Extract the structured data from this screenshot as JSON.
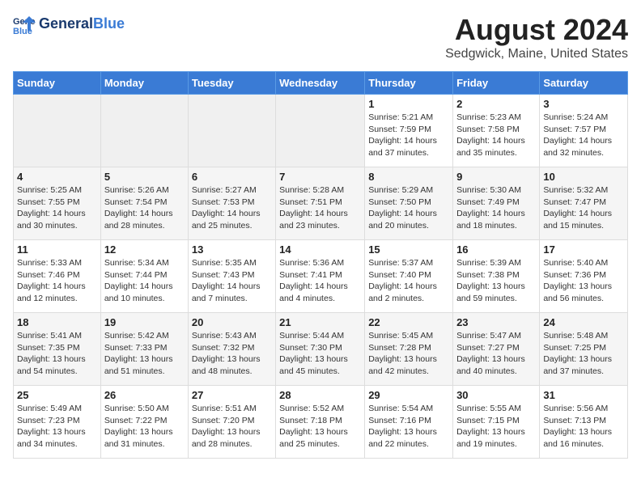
{
  "header": {
    "logo_line1": "General",
    "logo_line2": "Blue",
    "title": "August 2024",
    "subtitle": "Sedgwick, Maine, United States"
  },
  "weekdays": [
    "Sunday",
    "Monday",
    "Tuesday",
    "Wednesday",
    "Thursday",
    "Friday",
    "Saturday"
  ],
  "weeks": [
    [
      {
        "day": "",
        "empty": true
      },
      {
        "day": "",
        "empty": true
      },
      {
        "day": "",
        "empty": true
      },
      {
        "day": "",
        "empty": true
      },
      {
        "day": "1",
        "sunrise": "5:21 AM",
        "sunset": "7:59 PM",
        "daylight": "14 hours and 37 minutes."
      },
      {
        "day": "2",
        "sunrise": "5:23 AM",
        "sunset": "7:58 PM",
        "daylight": "14 hours and 35 minutes."
      },
      {
        "day": "3",
        "sunrise": "5:24 AM",
        "sunset": "7:57 PM",
        "daylight": "14 hours and 32 minutes."
      }
    ],
    [
      {
        "day": "4",
        "sunrise": "5:25 AM",
        "sunset": "7:55 PM",
        "daylight": "14 hours and 30 minutes."
      },
      {
        "day": "5",
        "sunrise": "5:26 AM",
        "sunset": "7:54 PM",
        "daylight": "14 hours and 28 minutes."
      },
      {
        "day": "6",
        "sunrise": "5:27 AM",
        "sunset": "7:53 PM",
        "daylight": "14 hours and 25 minutes."
      },
      {
        "day": "7",
        "sunrise": "5:28 AM",
        "sunset": "7:51 PM",
        "daylight": "14 hours and 23 minutes."
      },
      {
        "day": "8",
        "sunrise": "5:29 AM",
        "sunset": "7:50 PM",
        "daylight": "14 hours and 20 minutes."
      },
      {
        "day": "9",
        "sunrise": "5:30 AM",
        "sunset": "7:49 PM",
        "daylight": "14 hours and 18 minutes."
      },
      {
        "day": "10",
        "sunrise": "5:32 AM",
        "sunset": "7:47 PM",
        "daylight": "14 hours and 15 minutes."
      }
    ],
    [
      {
        "day": "11",
        "sunrise": "5:33 AM",
        "sunset": "7:46 PM",
        "daylight": "14 hours and 12 minutes."
      },
      {
        "day": "12",
        "sunrise": "5:34 AM",
        "sunset": "7:44 PM",
        "daylight": "14 hours and 10 minutes."
      },
      {
        "day": "13",
        "sunrise": "5:35 AM",
        "sunset": "7:43 PM",
        "daylight": "14 hours and 7 minutes."
      },
      {
        "day": "14",
        "sunrise": "5:36 AM",
        "sunset": "7:41 PM",
        "daylight": "14 hours and 4 minutes."
      },
      {
        "day": "15",
        "sunrise": "5:37 AM",
        "sunset": "7:40 PM",
        "daylight": "14 hours and 2 minutes."
      },
      {
        "day": "16",
        "sunrise": "5:39 AM",
        "sunset": "7:38 PM",
        "daylight": "13 hours and 59 minutes."
      },
      {
        "day": "17",
        "sunrise": "5:40 AM",
        "sunset": "7:36 PM",
        "daylight": "13 hours and 56 minutes."
      }
    ],
    [
      {
        "day": "18",
        "sunrise": "5:41 AM",
        "sunset": "7:35 PM",
        "daylight": "13 hours and 54 minutes."
      },
      {
        "day": "19",
        "sunrise": "5:42 AM",
        "sunset": "7:33 PM",
        "daylight": "13 hours and 51 minutes."
      },
      {
        "day": "20",
        "sunrise": "5:43 AM",
        "sunset": "7:32 PM",
        "daylight": "13 hours and 48 minutes."
      },
      {
        "day": "21",
        "sunrise": "5:44 AM",
        "sunset": "7:30 PM",
        "daylight": "13 hours and 45 minutes."
      },
      {
        "day": "22",
        "sunrise": "5:45 AM",
        "sunset": "7:28 PM",
        "daylight": "13 hours and 42 minutes."
      },
      {
        "day": "23",
        "sunrise": "5:47 AM",
        "sunset": "7:27 PM",
        "daylight": "13 hours and 40 minutes."
      },
      {
        "day": "24",
        "sunrise": "5:48 AM",
        "sunset": "7:25 PM",
        "daylight": "13 hours and 37 minutes."
      }
    ],
    [
      {
        "day": "25",
        "sunrise": "5:49 AM",
        "sunset": "7:23 PM",
        "daylight": "13 hours and 34 minutes."
      },
      {
        "day": "26",
        "sunrise": "5:50 AM",
        "sunset": "7:22 PM",
        "daylight": "13 hours and 31 minutes."
      },
      {
        "day": "27",
        "sunrise": "5:51 AM",
        "sunset": "7:20 PM",
        "daylight": "13 hours and 28 minutes."
      },
      {
        "day": "28",
        "sunrise": "5:52 AM",
        "sunset": "7:18 PM",
        "daylight": "13 hours and 25 minutes."
      },
      {
        "day": "29",
        "sunrise": "5:54 AM",
        "sunset": "7:16 PM",
        "daylight": "13 hours and 22 minutes."
      },
      {
        "day": "30",
        "sunrise": "5:55 AM",
        "sunset": "7:15 PM",
        "daylight": "13 hours and 19 minutes."
      },
      {
        "day": "31",
        "sunrise": "5:56 AM",
        "sunset": "7:13 PM",
        "daylight": "13 hours and 16 minutes."
      }
    ]
  ],
  "labels": {
    "sunrise_prefix": "Sunrise: ",
    "sunset_prefix": "Sunset: ",
    "daylight_prefix": "Daylight: "
  }
}
